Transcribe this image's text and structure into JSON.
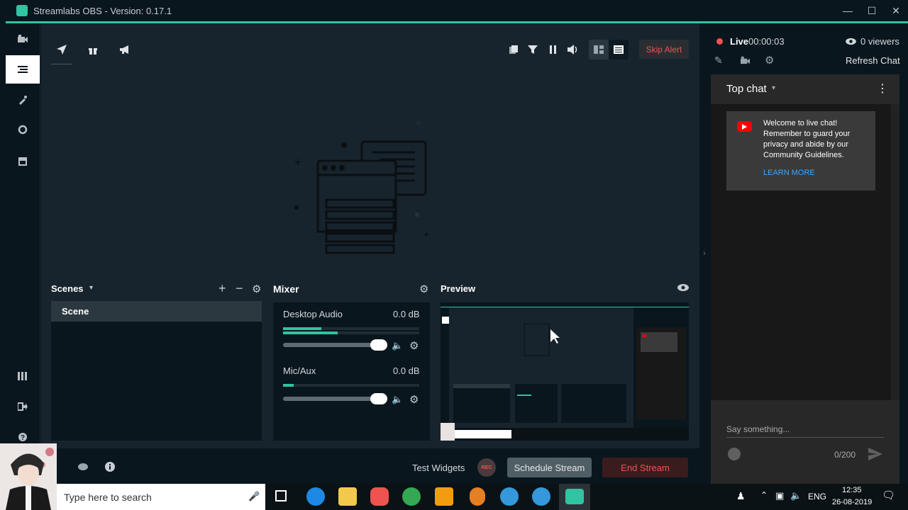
{
  "window": {
    "title": "Streamlabs OBS - Version: 0.17.1"
  },
  "toolbar": {
    "skip_alert_label": "Skip Alert"
  },
  "scenes": {
    "title": "Scenes",
    "items": [
      "Scene"
    ]
  },
  "mixer": {
    "title": "Mixer",
    "sources": [
      {
        "name": "Desktop Audio",
        "db": "0.0 dB",
        "level": 0.28
      },
      {
        "name": "Mic/Aux",
        "db": "0.0 dB",
        "level": 0.08
      }
    ]
  },
  "preview": {
    "title": "Preview"
  },
  "footer": {
    "test_widgets_label": "Test Widgets",
    "rec_label": "REC",
    "schedule_label": "Schedule Stream",
    "end_stream_label": "End Stream"
  },
  "live": {
    "status_label": "Live",
    "time": "00:00:03",
    "viewers": "0 viewers",
    "refresh_chat_label": "Refresh Chat"
  },
  "chat": {
    "mode_label": "Top chat",
    "welcome_text": "Welcome to live chat! Remember to guard your privacy and abide by our Community Guidelines.",
    "learn_more_label": "LEARN MORE",
    "input_placeholder": "Say something...",
    "char_count": "0/200"
  },
  "taskbar": {
    "search_placeholder": "Type here to search",
    "language": "ENG",
    "time": "12:35",
    "date": "26-08-2019"
  },
  "colors": {
    "accent": "#31c3a2",
    "danger": "#ef5350",
    "youtube_red": "#ff0000"
  },
  "icons": [
    "studio-icon",
    "dashboard-icon",
    "themes-icon",
    "chatbot-icon",
    "store-icon",
    "layout-icon",
    "logout-icon",
    "help-icon"
  ]
}
